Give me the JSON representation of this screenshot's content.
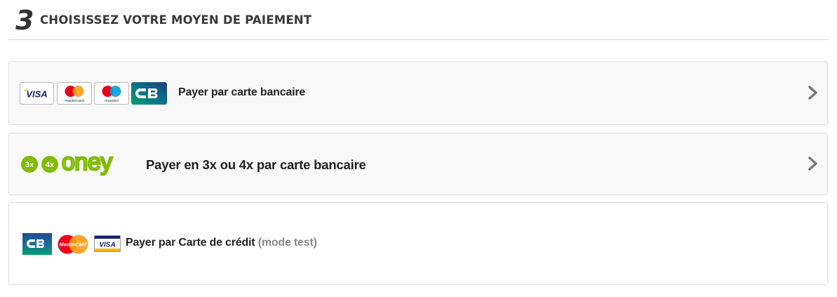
{
  "header": {
    "step_number": "3",
    "title": "CHOISISSEZ VOTRE MOYEN DE PAIEMENT"
  },
  "options": [
    {
      "label": "Payer par carte bancaire",
      "logos": [
        "visa-logo",
        "mastercard-logo",
        "maestro-logo",
        "cb-logo"
      ],
      "logo_texts": {
        "visa": "VISA",
        "mastercard": "mastercard",
        "maestro": "maestro"
      }
    },
    {
      "label": "Payer en 3x ou 4x par carte bancaire",
      "logos": [
        "oney-3x-badge",
        "oney-4x-badge",
        "oney-logo"
      ],
      "logo_texts": {
        "badge_3x": "3x",
        "badge_4x": "4x",
        "brand": "oney"
      }
    },
    {
      "label": "Payer par Carte de crédit",
      "suffix": "(mode test)",
      "logos": [
        "cb-logo",
        "mastercard-logo",
        "visa-logo"
      ],
      "logo_texts": {
        "mastercard": "MasterCard",
        "visa": "VISA"
      }
    }
  ],
  "colors": {
    "oney_green": "#80bc00",
    "mastercard_red": "#eb001b",
    "mastercard_orange": "#f79e1b",
    "maestro_blue": "#00a1df",
    "visa_blue": "#1a1f71",
    "visa_gold": "#f7b600",
    "cb_green": "#00a26b",
    "cb_blue": "#1e4e8c",
    "chevron": "#777777"
  }
}
